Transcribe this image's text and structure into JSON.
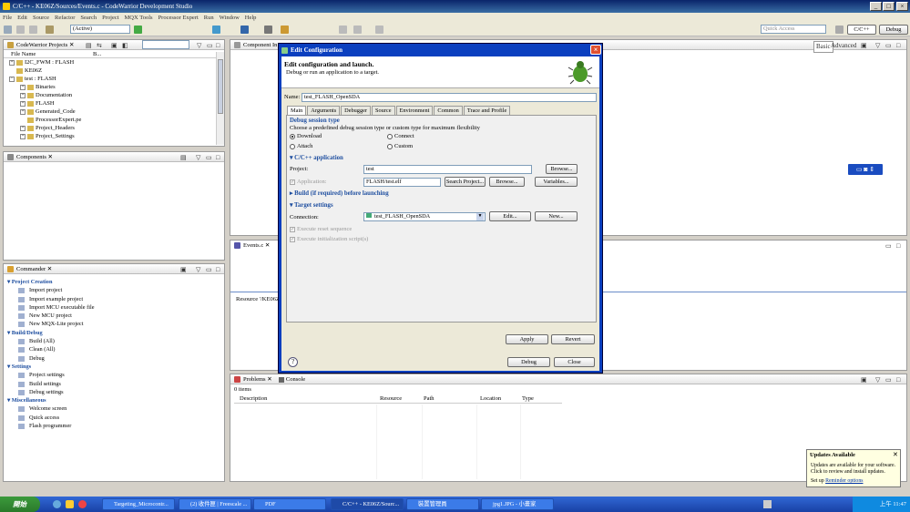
{
  "window": {
    "title": "C/C++ - KE06Z/Sources/Events.c - CodeWarrior Development Studio"
  },
  "menu": [
    "File",
    "Edit",
    "Source",
    "Refactor",
    "Search",
    "Project",
    "MQX Tools",
    "Processor Expert",
    "Run",
    "Window",
    "Help"
  ],
  "toolbar": {
    "config_select": "(Active)",
    "quick_access_placeholder": "Quick Access",
    "perspective_cpp": "C/C++",
    "perspective_debug": "Debug"
  },
  "projects_panel": {
    "title": "CodeWarrior Projects",
    "col_file": "File Name",
    "col_b": "B...",
    "items": [
      {
        "label": "I2C_FWM : FLASH",
        "indent": 0,
        "expander": "+"
      },
      {
        "label": "KE06Z",
        "indent": 0,
        "expander": ""
      },
      {
        "label": "test : FLASH",
        "indent": 0,
        "expander": "-"
      },
      {
        "label": "Binaries",
        "indent": 1,
        "expander": "+"
      },
      {
        "label": "Documentation",
        "indent": 1,
        "expander": "+"
      },
      {
        "label": "FLASH",
        "indent": 1,
        "expander": "+"
      },
      {
        "label": "Generated_Code",
        "indent": 1,
        "expander": "+"
      },
      {
        "label": "ProcessorExpert.pe",
        "indent": 1,
        "expander": ""
      },
      {
        "label": "Project_Headers",
        "indent": 1,
        "expander": "+"
      },
      {
        "label": "Project_Settings",
        "indent": 1,
        "expander": "+"
      }
    ]
  },
  "components_panel": {
    "title": "Components"
  },
  "commander_panel": {
    "title": "Commander",
    "sections": [
      {
        "title": "Project Creation",
        "items": [
          "Import project",
          "Import example project",
          "Import MCU executable file",
          "New MCU project",
          "New MQX-Lite project"
        ]
      },
      {
        "title": "Build/Debug",
        "items": [
          "Build  (All)",
          "Clean  (All)",
          "Debug"
        ]
      },
      {
        "title": "Settings",
        "items": [
          "Project settings",
          "Build settings",
          "Debug settings"
        ]
      },
      {
        "title": "Miscellaneous",
        "items": [
          "Welcome screen",
          "Quick access",
          "Flash programmer"
        ]
      }
    ]
  },
  "component_inspector": {
    "title": "Component In",
    "basic": "Basic",
    "advanced": "Advanced"
  },
  "events_panel": {
    "title": "Events.c",
    "resource_text": "Resource '/KE06Z"
  },
  "problems_panel": {
    "tab_problems": "Problems",
    "tab_console": "Console",
    "count": "0 items",
    "columns": [
      "Description",
      "Resource",
      "Path",
      "Location",
      "Type"
    ]
  },
  "dialog": {
    "title": "Edit Configuration",
    "heading": "Edit configuration and launch.",
    "subheading": "Debug or run an application to a target.",
    "name_label": "Name:",
    "name_value": "test_FLASH_OpenSDA",
    "tabs": [
      "Main",
      "Arguments",
      "Debugger",
      "Source",
      "Environment",
      "Common",
      "Trace and Profile"
    ],
    "debug_session_type": "Debug session type",
    "debug_session_desc": "Choose a predefined debug session type or custom type for maximum flexibility",
    "radios": [
      "Download",
      "Connect",
      "Attach",
      "Custom"
    ],
    "cpp_app_section": "C/C++ application",
    "project_label": "Project:",
    "project_value": "test",
    "browse": "Browse...",
    "application_label": "Application:",
    "application_value": "FLASH/test.elf",
    "search_project": "Search Project...",
    "variables": "Variables...",
    "build_section": "Build (if required) before launching",
    "target_section": "Target settings",
    "connection_label": "Connection:",
    "connection_value": "test_FLASH_OpenSDA",
    "edit": "Edit...",
    "new": "New...",
    "reset_seq": "Execute reset sequence",
    "init_scripts": "Execute initialization script(s)",
    "apply": "Apply",
    "revert": "Revert",
    "debug": "Debug",
    "close": "Close"
  },
  "updates_popup": {
    "title": "Updates Available",
    "body": "Updates are available for your software. Click to review and install updates.",
    "setup": "Set up",
    "reminder": "Reminder options"
  },
  "taskbar": {
    "start": "開始",
    "tasks": [
      "Targeting_Microcontr...",
      "(2) 收件匣 | Freescale ...",
      "PDF",
      "C/C++ - KE06Z/Sourc...",
      "裝置管理員",
      "jpg1.JPG - 小畫家"
    ],
    "clock": "上午 11:47"
  }
}
